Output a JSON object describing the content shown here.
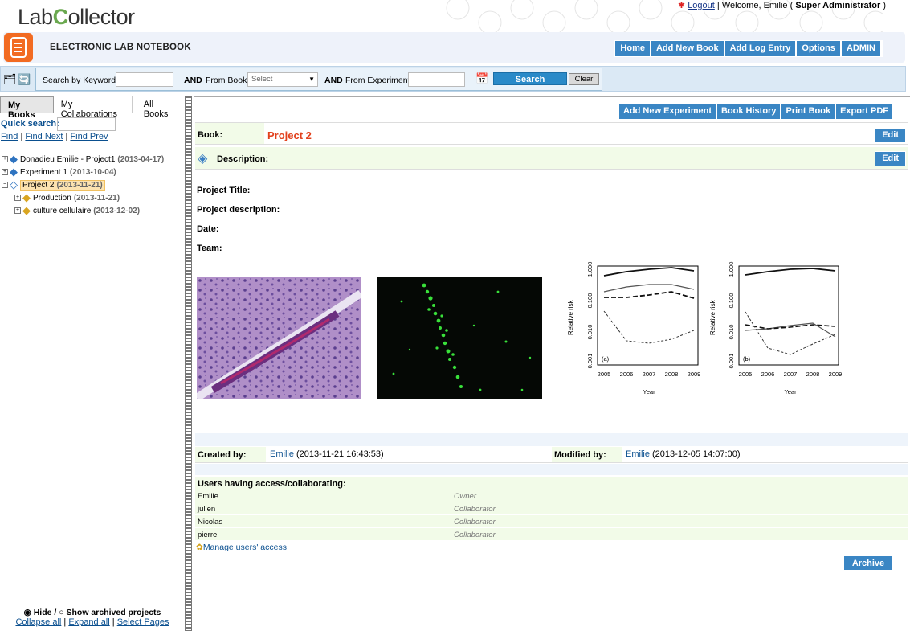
{
  "header": {
    "logo_text_a": "Lab",
    "logo_text_c": "C",
    "logo_text_b": "ollector",
    "logout": "Logout",
    "welcome": "| Welcome, Emilie (",
    "role": "Super Administrator",
    "welcome_end": ")"
  },
  "titlebar": {
    "title": "ELECTRONIC LAB NOTEBOOK",
    "nav": [
      "Home",
      "Add New Book",
      "Add Log Entry",
      "Options",
      "ADMIN"
    ]
  },
  "search": {
    "keyword_label": "Search by Keyword",
    "and1": "AND",
    "from_book_label": "From Book",
    "book_select": "Select",
    "and2": "AND",
    "from_exp_label": "From Experiment",
    "search_button": "Search",
    "clear_button": "Clear"
  },
  "left": {
    "tabs": [
      "My Books",
      "My Collaborations",
      "All Books"
    ],
    "quick_search": "Quick search:",
    "find": "Find",
    "find_next": "Find Next",
    "find_prev": "Find Prev",
    "tree": [
      {
        "label": "Donadieu Emilie - Project1",
        "date": "(2013-04-17)"
      },
      {
        "label": "Experiment 1",
        "date": "(2013-10-04)"
      },
      {
        "label": "Project 2",
        "date": "(2013-11-21)"
      },
      {
        "label": "Production",
        "date": "(2013-11-21)"
      },
      {
        "label": "culture cellulaire",
        "date": "(2013-12-02)"
      }
    ],
    "hide": "Hide /",
    "show_archived": "Show archived projects",
    "collapse_all": "Collapse all",
    "expand_all": "Expand all",
    "select_pages": "Select Pages"
  },
  "main": {
    "actions": [
      "Add New Experiment",
      "Book History",
      "Print Book",
      "Export PDF"
    ],
    "book_label": "Book:",
    "book_name": "Project 2",
    "edit": "Edit",
    "description_label": "Description:",
    "fields": [
      "Project Title:",
      "Project description:",
      "Date:",
      "Team:"
    ],
    "created_by_label": "Created by:",
    "created_user": "Emilie",
    "created_date": "(2013-11-21 16:43:53)",
    "modified_by_label": "Modified by:",
    "modified_user": "Emilie",
    "modified_date": "(2013-12-05 14:07:00)",
    "users_header": "Users having access/collaborating:",
    "users": [
      {
        "name": "Emilie",
        "role": "Owner"
      },
      {
        "name": "julien",
        "role": "Collaborator"
      },
      {
        "name": "Nicolas",
        "role": "Collaborator"
      },
      {
        "name": "pierre",
        "role": "Collaborator"
      }
    ],
    "manage_access": "Manage users' access",
    "archive": "Archive"
  },
  "plots": {
    "ylabel": "Relative risk",
    "xlabel": "Year",
    "x_ticks": [
      "2005",
      "2006",
      "2007",
      "2008",
      "2009"
    ],
    "y_ticks": [
      "1.000",
      "0.100",
      "0.010",
      "0.001"
    ],
    "panel_a": "(a)",
    "panel_b": "(b)"
  }
}
